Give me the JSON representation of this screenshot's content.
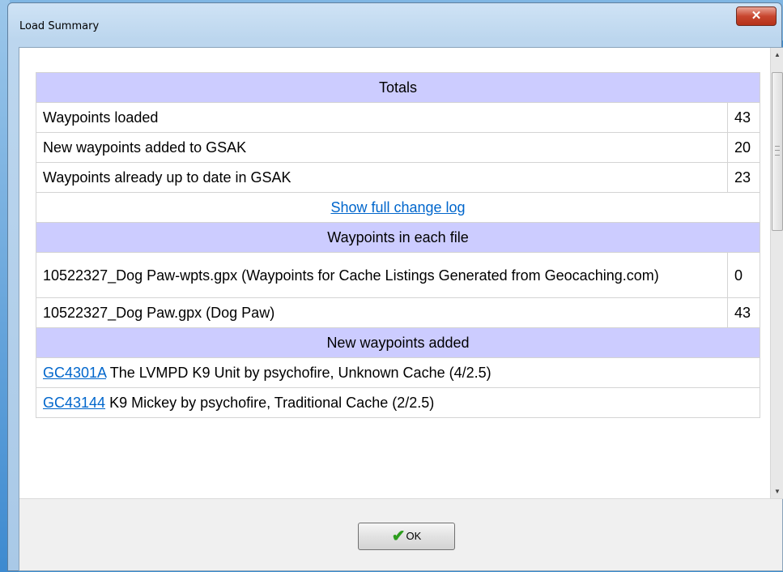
{
  "window": {
    "title": "Load Summary",
    "close_glyph": "✕",
    "ok_label": "OK"
  },
  "totals": {
    "header": "Totals",
    "rows": [
      {
        "label": "Waypoints loaded",
        "value": "43"
      },
      {
        "label": "New waypoints added to GSAK",
        "value": "20"
      },
      {
        "label": "Waypoints already up to date in GSAK",
        "value": "23"
      }
    ],
    "change_log_link": "Show full change log"
  },
  "files": {
    "header": "Waypoints in each file",
    "rows": [
      {
        "label": "10522327_Dog Paw-wpts.gpx (Waypoints for Cache Listings Generated from Geocaching.com)",
        "value": "0"
      },
      {
        "label": "10522327_Dog Paw.gpx (Dog Paw)",
        "value": "43"
      }
    ]
  },
  "new_waypoints": {
    "header": "New waypoints added",
    "rows": [
      {
        "code": "GC4301A",
        "text": " The LVMPD K9 Unit by psychofire, Unknown Cache (4/2.5)"
      },
      {
        "code": "GC43144",
        "text": " K9 Mickey by psychofire, Traditional Cache (2/2.5)"
      }
    ]
  },
  "icons": {
    "ok": "checkmark-icon",
    "close": "close-icon"
  },
  "colors": {
    "section_header_bg": "#ccccff",
    "link": "#0066cc",
    "close_button": "#c8462f"
  }
}
